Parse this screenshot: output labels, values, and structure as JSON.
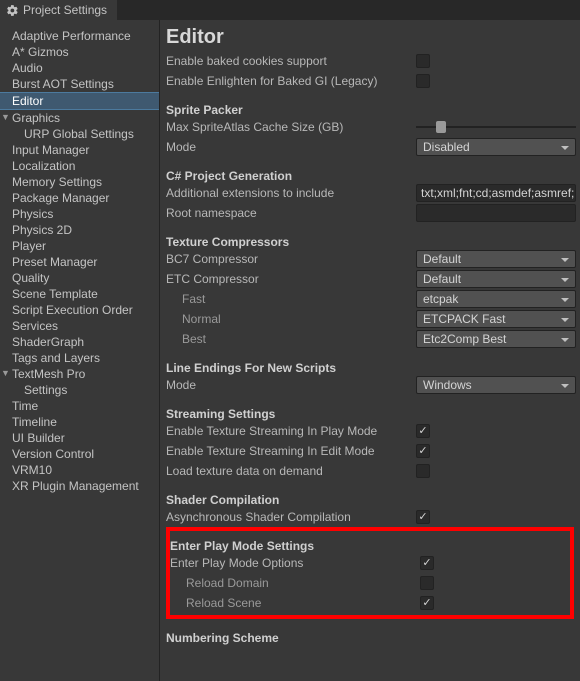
{
  "window": {
    "tab_title": "Project Settings"
  },
  "sidebar": {
    "items": [
      {
        "label": "Adaptive Performance"
      },
      {
        "label": "A* Gizmos"
      },
      {
        "label": "Audio"
      },
      {
        "label": "Burst AOT Settings"
      },
      {
        "label": "Editor",
        "selected": true
      },
      {
        "label": "Graphics",
        "expander": true
      },
      {
        "label": "URP Global Settings",
        "level": 1
      },
      {
        "label": "Input Manager"
      },
      {
        "label": "Localization"
      },
      {
        "label": "Memory Settings"
      },
      {
        "label": "Package Manager"
      },
      {
        "label": "Physics"
      },
      {
        "label": "Physics 2D"
      },
      {
        "label": "Player"
      },
      {
        "label": "Preset Manager"
      },
      {
        "label": "Quality"
      },
      {
        "label": "Scene Template"
      },
      {
        "label": "Script Execution Order"
      },
      {
        "label": "Services"
      },
      {
        "label": "ShaderGraph"
      },
      {
        "label": "Tags and Layers"
      },
      {
        "label": "TextMesh Pro",
        "expander": true
      },
      {
        "label": "Settings",
        "level": 1
      },
      {
        "label": "Time"
      },
      {
        "label": "Timeline"
      },
      {
        "label": "UI Builder"
      },
      {
        "label": "Version Control"
      },
      {
        "label": "VRM10"
      },
      {
        "label": "XR Plugin Management"
      }
    ]
  },
  "page": {
    "title": "Editor",
    "rows": {
      "baked_cookies": "Enable baked cookies support",
      "enlighten_legacy": "Enable Enlighten for Baked GI (Legacy)",
      "sprite_packer_header": "Sprite Packer",
      "max_atlas_cache": "Max SpriteAtlas Cache Size (GB)",
      "mode": "Mode",
      "mode_value": "Disabled",
      "csproj_header": "C# Project Generation",
      "add_ext": "Additional extensions to include",
      "add_ext_value": "txt;xml;fnt;cd;asmdef;asmref;rsp",
      "root_ns": "Root namespace",
      "texcomp_header": "Texture Compressors",
      "bc7": "BC7 Compressor",
      "bc7_value": "Default",
      "etc": "ETC Compressor",
      "etc_value": "Default",
      "fast": "Fast",
      "fast_value": "etcpak",
      "normal": "Normal",
      "normal_value": "ETCPACK Fast",
      "best": "Best",
      "best_value": "Etc2Comp Best",
      "line_endings_header": "Line Endings For New Scripts",
      "line_mode": "Mode",
      "line_mode_value": "Windows",
      "streaming_header": "Streaming Settings",
      "stream_play": "Enable Texture Streaming In Play Mode",
      "stream_edit": "Enable Texture Streaming In Edit Mode",
      "load_on_demand": "Load texture data on demand",
      "shader_header": "Shader Compilation",
      "async_shader": "Asynchronous Shader Compilation",
      "playmode_header": "Enter Play Mode Settings",
      "playmode_opts": "Enter Play Mode Options",
      "reload_domain": "Reload Domain",
      "reload_scene": "Reload Scene",
      "numbering_header": "Numbering Scheme"
    }
  }
}
